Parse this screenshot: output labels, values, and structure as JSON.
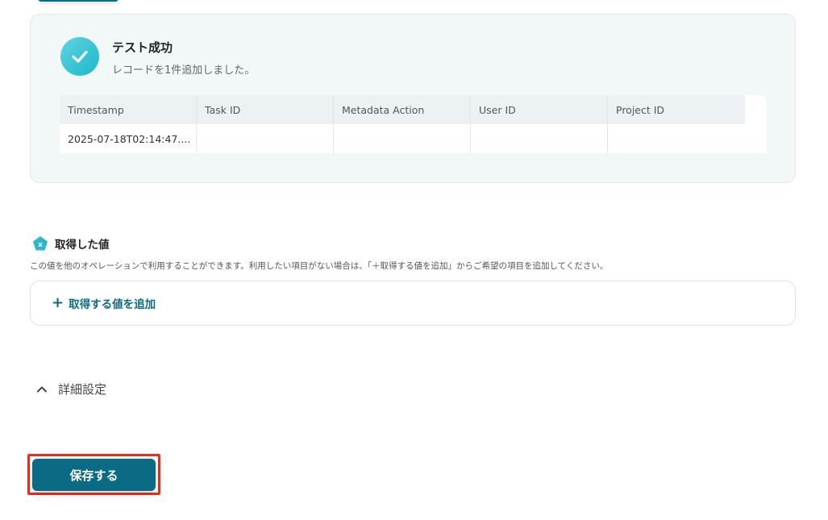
{
  "test_result": {
    "title": "テスト成功",
    "subtitle": "レコードを1件追加しました。",
    "table": {
      "headers": [
        "Timestamp",
        "Task ID",
        "Metadata Action",
        "User ID",
        "Project ID"
      ],
      "row": [
        "2025-07-18T02:14:47....",
        "",
        "",
        "",
        ""
      ]
    }
  },
  "fetched_values": {
    "title": "取得した値",
    "description": "この値を他のオペレーションで利用することができます。利用したい項目がない場合は、「＋取得する値を追加」からご希望の項目を追加してください。",
    "add_label": "取得する値を追加",
    "icon_glyph": "x"
  },
  "details": {
    "label": "詳細設定"
  },
  "save": {
    "label": "保存する"
  },
  "colors": {
    "primary": "#0b6b84",
    "success_gradient_start": "#5fd3e4",
    "success_gradient_end": "#1cb8c8",
    "highlight_border": "#e8301c"
  }
}
